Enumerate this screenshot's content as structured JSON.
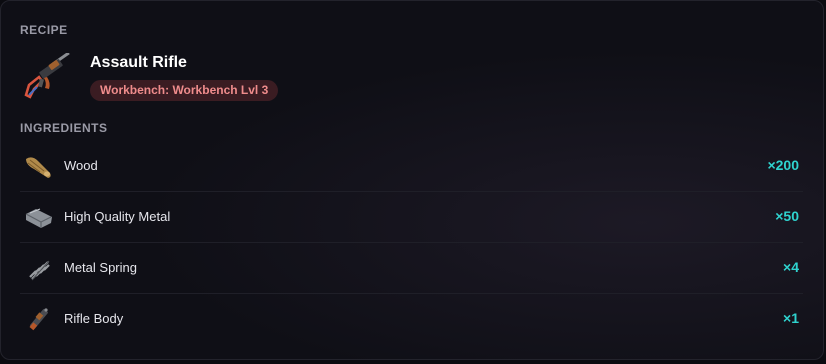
{
  "recipe": {
    "section_label": "RECIPE",
    "title": "Assault Rifle",
    "station": "Workbench: Workbench Lvl 3",
    "icon": "assault-rifle-icon"
  },
  "ingredients": {
    "section_label": "INGREDIENTS",
    "items": [
      {
        "name": "Wood",
        "qty": "×200",
        "icon": "wood-icon"
      },
      {
        "name": "High Quality Metal",
        "qty": "×50",
        "icon": "high-quality-metal-icon"
      },
      {
        "name": "Metal Spring",
        "qty": "×4",
        "icon": "metal-spring-icon"
      },
      {
        "name": "Rifle Body",
        "qty": "×1",
        "icon": "rifle-body-icon"
      }
    ]
  },
  "colors": {
    "background": "#0f0f16",
    "accent_quantity": "#2fd3cf",
    "badge_text": "#ef8c8c",
    "badge_background": "#3a1c22"
  }
}
